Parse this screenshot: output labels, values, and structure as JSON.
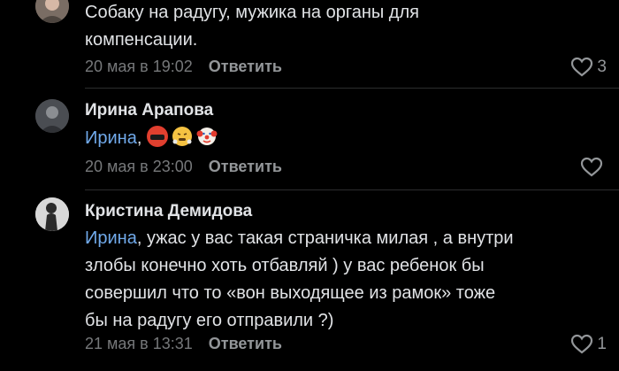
{
  "comments": [
    {
      "text_lines": [
        "Собаку на радугу, мужика на органы для",
        "компенсации."
      ],
      "date": "20 мая в 19:02",
      "reply_label": "Ответить",
      "like_count": "3",
      "avatar_icon": "user-photo"
    },
    {
      "author": "Ирина Арапова",
      "mention": "Ирина",
      "after_mention": ",",
      "emojis": [
        "cursing-face-icon",
        "steaming-nose-face-icon",
        "clown-face-icon"
      ],
      "date": "20 мая в 23:00",
      "reply_label": "Ответить",
      "like_count": "",
      "avatar_icon": "user-photo"
    },
    {
      "author": "Кристина Демидова",
      "mention": "Ирина",
      "text_first": ", ужас у вас такая страничка милая , а внутри",
      "text_lines": [
        "злобы конечно хоть отбавляй ) у вас ребенок бы",
        "совершил что то «вон выходящее из рамок» тоже",
        "бы на радугу его отправили ?)"
      ],
      "date": "21 мая в 13:31",
      "reply_label": "Ответить",
      "like_count": "1",
      "avatar_icon": "user-photo"
    }
  ],
  "colors": {
    "background": "#000000",
    "text": "#e1e3e6",
    "mention": "#71aaeb",
    "meta": "#76787a",
    "divider": "#2c2d2e"
  }
}
